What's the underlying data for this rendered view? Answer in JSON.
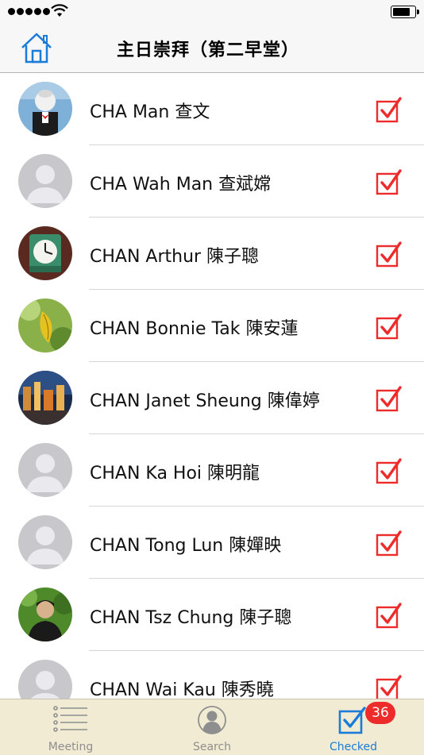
{
  "nav": {
    "title": "主日崇拜（第二早堂）"
  },
  "people": [
    {
      "name": "CHA Man 查文",
      "avatar": "photo-mascot",
      "checked": true
    },
    {
      "name": "CHA Wah Man 查斌嫦",
      "avatar": "placeholder",
      "checked": true
    },
    {
      "name": "CHAN Arthur 陳子聰",
      "avatar": "photo-clock",
      "checked": true
    },
    {
      "name": "CHAN Bonnie Tak 陳安蓮",
      "avatar": "photo-leaf",
      "checked": true
    },
    {
      "name": "CHAN Janet Sheung 陳偉婷",
      "avatar": "photo-city",
      "checked": true
    },
    {
      "name": "CHAN Ka Hoi 陳明龍",
      "avatar": "placeholder",
      "checked": true
    },
    {
      "name": "CHAN Tong Lun 陳嬋映",
      "avatar": "placeholder",
      "checked": true
    },
    {
      "name": "CHAN Tsz Chung 陳子聰",
      "avatar": "photo-person",
      "checked": true
    },
    {
      "name": "CHAN Wai Kau 陳秀曉",
      "avatar": "placeholder",
      "checked": true
    }
  ],
  "tabs": {
    "meeting": "Meeting",
    "search": "Search",
    "checked": "Checked"
  },
  "badge": {
    "checked_count": "36"
  },
  "colors": {
    "accent": "#1a7bd8",
    "check_red": "#ee2b2b",
    "tab_bar_bg": "#f2ebd4"
  }
}
